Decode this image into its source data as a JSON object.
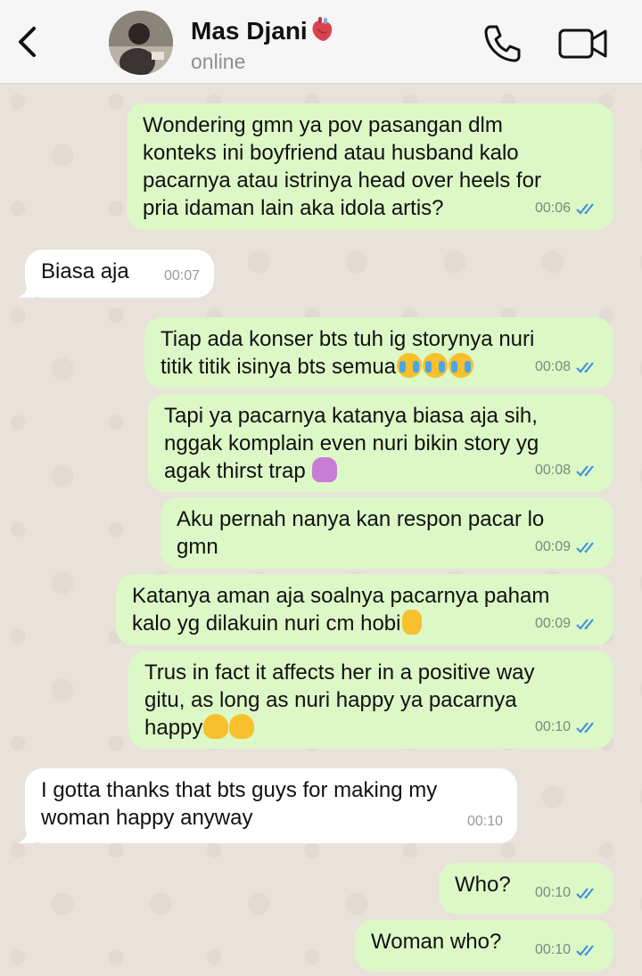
{
  "header": {
    "contact_name": "Mas Djani",
    "status": "online"
  },
  "icons": {
    "back": "chevron-left-icon",
    "call": "phone-icon",
    "video": "video-camera-icon",
    "heart": "anatomical-heart-emoji",
    "read_receipt": "double-check-icon"
  },
  "colors": {
    "outgoing_bubble": "#dcf8c6",
    "incoming_bubble": "#ffffff",
    "read_ticks": "#3a8dde",
    "chat_background": "#e8e2da"
  },
  "messages": [
    {
      "direction": "out",
      "text": "Wondering gmn ya pov pasangan dlm\nkonteks ini boyfriend atau husband kalo\npacarnya atau istrinya head over heels for\npria idaman lain aka idola artis?",
      "time": "00:06"
    },
    {
      "direction": "in",
      "text": "Biasa aja",
      "time": "00:07"
    },
    {
      "direction": "out",
      "text": "Tiap ada konser bts tuh ig storynya nuri\ntitik titik isinya bts semua",
      "emoji": "😭😭😭",
      "time": "00:08"
    },
    {
      "direction": "out",
      "text": "Tapi ya pacarnya katanya biasa aja sih,\nnggak komplain even nuri bikin story yg\nagak thirst trap",
      "emoji": "💁🏼‍♀️",
      "time": "00:08"
    },
    {
      "direction": "out",
      "text": "Aku pernah nanya kan respon pacar lo\ngmn",
      "time": "00:09"
    },
    {
      "direction": "out",
      "text": "Katanya aman aja soalnya pacarnya paham\nkalo yg dilakuin nuri cm hobi",
      "emoji": "👌",
      "time": "00:09"
    },
    {
      "direction": "out",
      "text": "Trus in fact it affects her in a positive way\ngitu, as long as nuri happy ya pacarnya\nhappy",
      "emoji": "🫠🫠",
      "time": "00:10"
    },
    {
      "direction": "in",
      "text": "I gotta thanks that bts guys for making my\nwoman happy anyway",
      "time": "00:10"
    },
    {
      "direction": "out",
      "text": "Who?",
      "time": "00:10"
    },
    {
      "direction": "out",
      "text": "Woman who?",
      "time": "00:10"
    }
  ]
}
